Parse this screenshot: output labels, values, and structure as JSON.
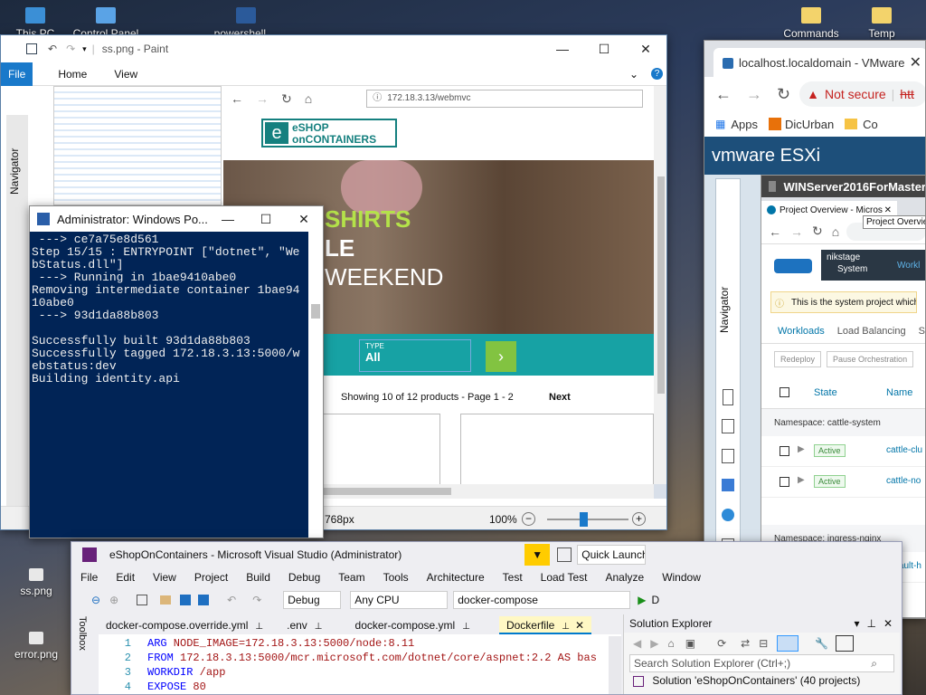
{
  "desktop": {
    "icons": [
      "This PC",
      "Control Panel",
      "powershell....",
      "Commands",
      "Temp",
      "ss.png",
      "error.png"
    ]
  },
  "paint": {
    "title": "ss.png - Paint",
    "menu": [
      "File",
      "Home",
      "View"
    ],
    "status_dim": "768px",
    "zoom": "100%",
    "navigator_label": "Navigator",
    "canvas": {
      "url": "172.18.3.13/webmvc",
      "logo_line1": "eSHOP",
      "logo_line2": "onCONTAINERS",
      "hero_line1": "SHIRTS",
      "hero_line2": "LE",
      "hero_line3": "WEEKEND",
      "type_label": "TYPE",
      "type_value": "All",
      "showing": "Showing 10 of 12 products - Page 1 - 2",
      "next": "Next"
    }
  },
  "powershell": {
    "title": "Administrator: Windows Po...",
    "lines": [
      " ---> ce7a75e8d561",
      "Step 15/15 : ENTRYPOINT [\"dotnet\", \"We",
      "bStatus.dll\"]",
      " ---> Running in 1bae9410abe0",
      "Removing intermediate container 1bae94",
      "10abe0",
      " ---> 93d1da88b803",
      "",
      "Successfully built 93d1da88b803",
      "Successfully tagged 172.18.3.13:5000/w",
      "ebstatus:dev",
      "Building identity.api"
    ]
  },
  "chrome": {
    "tab_title": "localhost.localdomain - VMware",
    "not_secure": "Not secure",
    "url_prefix": "htt",
    "bookmarks": [
      "Apps",
      "DicUrban",
      "Co"
    ],
    "esxi_brand": "vmware ESXi",
    "navigator_label": "Navigator",
    "vm": {
      "title": "WINServer2016ForMaster",
      "tab": "Project Overview - Micros",
      "tooltip": "Project Overview",
      "rancher": {
        "cluster": "nikstage",
        "project": "System",
        "workload_nav": "Workl",
        "banner": "This is the system project which",
        "tabs": [
          "Workloads",
          "Load Balancing",
          "S"
        ],
        "buttons": [
          "Redeploy",
          "Pause Orchestration"
        ],
        "col_state": "State",
        "col_name": "Name",
        "ns1": "Namespace: cattle-system",
        "ns2": "Namespace: ingress-nginx",
        "rows1": [
          {
            "state": "Active",
            "name": "cattle-clu"
          },
          {
            "state": "Active",
            "name": "cattle-no"
          }
        ],
        "rows2": [
          {
            "state": "Active",
            "name": "default-h"
          }
        ]
      }
    }
  },
  "vs": {
    "title": "eShopOnContainers - Microsoft Visual Studio  (Administrator)",
    "quick_launch": "Quick Launch",
    "menu": [
      "File",
      "Edit",
      "View",
      "Project",
      "Build",
      "Debug",
      "Team",
      "Tools",
      "Architecture",
      "Test",
      "Load Test",
      "Analyze",
      "Window"
    ],
    "config": "Debug",
    "platform": "Any CPU",
    "startup": "docker-compose",
    "run_label": "D",
    "toolbox": "Toolbox",
    "doc_tabs": [
      "docker-compose.override.yml",
      ".env",
      "docker-compose.yml",
      "Dockerfile"
    ],
    "code": [
      {
        "n": "1",
        "kw": "ARG",
        "rest": " NODE_IMAGE=172.18.3.13:5000/node:8.11"
      },
      {
        "n": "2",
        "kw": "FROM",
        "rest": " 172.18.3.13:5000/mcr.microsoft.com/dotnet/core/aspnet:2.2 AS bas"
      },
      {
        "n": "3",
        "kw": "WORKDIR",
        "rest": " /app"
      },
      {
        "n": "4",
        "kw": "EXPOSE",
        "rest": " 80"
      }
    ],
    "solution_explorer": {
      "title": "Solution Explorer",
      "search_placeholder": "Search Solution Explorer (Ctrl+;)",
      "root": "Solution 'eShopOnContainers' (40 projects)"
    }
  },
  "colors": {
    "accent_teal": "#17a2a4",
    "vs_purple": "#68217a",
    "ps_blue": "#012456",
    "esxi_blue": "#1d4f7a"
  }
}
